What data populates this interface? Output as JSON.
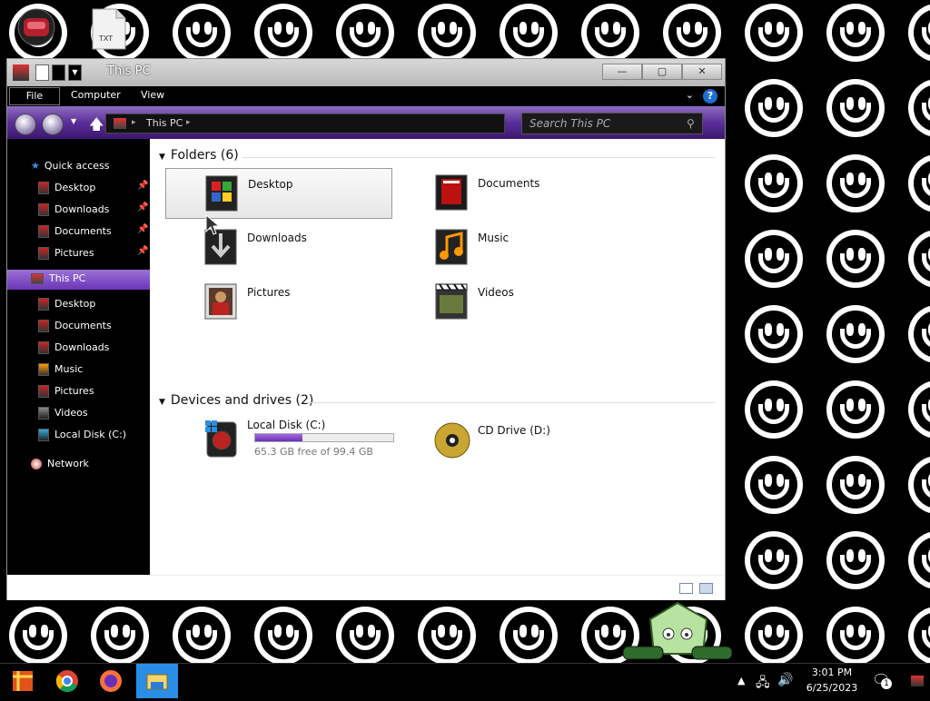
{
  "window": {
    "title": "This PC",
    "minimize": "—",
    "maximize": "▢",
    "close": "✕"
  },
  "ribbon": {
    "tabs": [
      "File",
      "Computer",
      "View"
    ],
    "help": "?"
  },
  "address": {
    "path": "This PC",
    "search_placeholder": "Search This PC"
  },
  "nav": {
    "quick_access": "Quick access",
    "quick_items": [
      "Desktop",
      "Downloads",
      "Documents",
      "Pictures"
    ],
    "this_pc": "This PC",
    "pc_items": [
      "Desktop",
      "Documents",
      "Downloads",
      "Music",
      "Pictures",
      "Videos",
      "Local Disk (C:)"
    ],
    "network": "Network"
  },
  "content": {
    "folders_header": "Folders (6)",
    "folders": [
      "Desktop",
      "Documents",
      "Downloads",
      "Music",
      "Pictures",
      "Videos"
    ],
    "devices_header": "Devices and drives (2)",
    "drives": [
      {
        "name": "Local Disk (C:)",
        "free": "65.3 GB free of 99.4 GB",
        "used_fraction": 0.343
      },
      {
        "name": "CD Drive (D:)"
      }
    ]
  },
  "desktop_icons": {
    "txt_label": "TXT"
  },
  "taskbar": {
    "time": "3:01 PM",
    "date": "6/25/2023",
    "notification_count": "1"
  },
  "colors": {
    "accent": "#6a35b6",
    "selection": "#8e5bd0"
  }
}
